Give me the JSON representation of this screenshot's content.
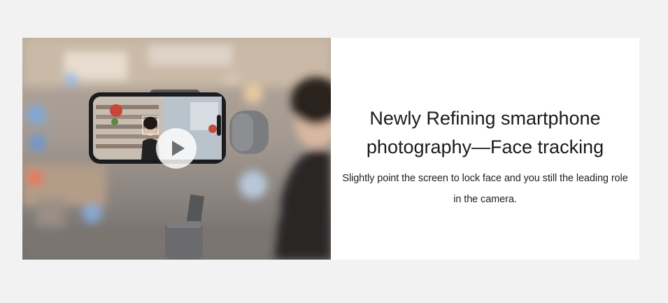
{
  "video": {
    "play_icon": "play-icon",
    "overlay_color": "#ffffff"
  },
  "feature": {
    "headline_line1": "Newly Refining smartphone",
    "headline_line2": "photography—Face tracking",
    "description_line1": "Slightly point the screen to lock face and you still the leading role",
    "description_line2": "in the camera."
  },
  "colors": {
    "page_background": "#f2f2f2",
    "card_background": "#ffffff",
    "text": "#1a1a1a"
  }
}
